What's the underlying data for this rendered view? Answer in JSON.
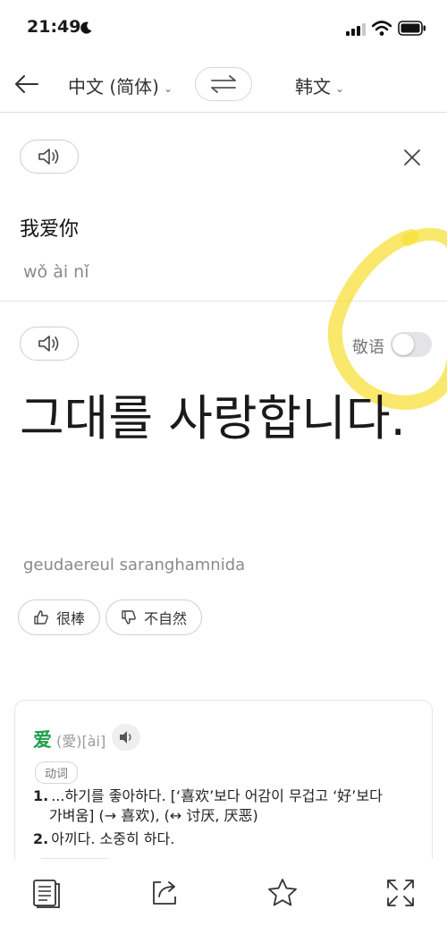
{
  "status": {
    "time": "21:49"
  },
  "header": {
    "source_lang": "中文 (简体)",
    "target_lang": "韩文"
  },
  "source": {
    "text": "我爱你",
    "pinyin": "wǒ ài nǐ"
  },
  "target": {
    "honorific_label": "敬语",
    "honorific_on": false,
    "text": "그대를 사랑합니다.",
    "romanization": "geudaereul saranghamnida"
  },
  "feedback": {
    "like_label": "很棒",
    "dislike_label": "不自然"
  },
  "dictionary": {
    "word": "爱",
    "traditional": "(愛)",
    "pinyin": "[ài]",
    "pos": "动词",
    "defs": [
      {
        "num": "1.",
        "line1": "...하기를 좋아하다. [‘喜欢’보다 어감이 무겁고 ‘好’보다",
        "line2": "가벼움] (→ 喜欢), (↔ 讨厌, 厌恶)"
      },
      {
        "num": "2.",
        "line1": "아끼다. 소중히 하다."
      }
    ]
  },
  "colors": {
    "accent_green": "#21a04a",
    "highlight": "#f7e03a"
  }
}
